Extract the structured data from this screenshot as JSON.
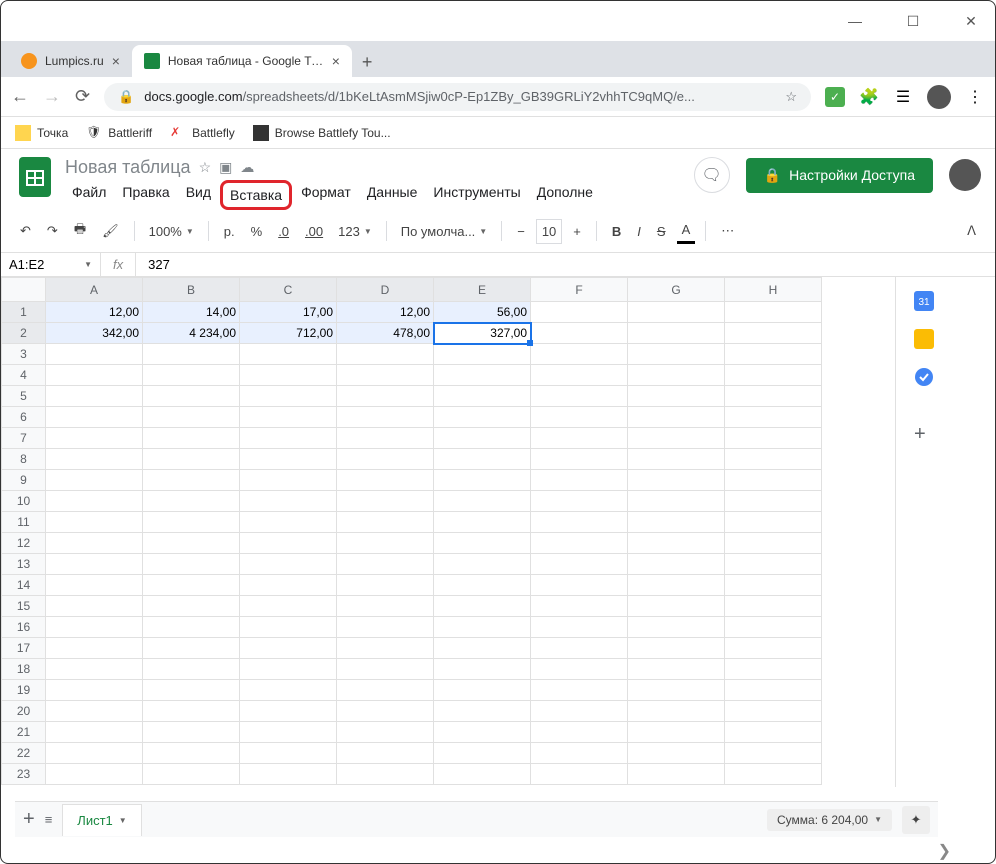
{
  "window": {
    "minimize": "—",
    "maximize": "☐",
    "close": "✕"
  },
  "tabs": [
    {
      "title": "Lumpics.ru",
      "active": false
    },
    {
      "title": "Новая таблица - Google Таблиц",
      "active": true
    }
  ],
  "newTab": "+",
  "addr": {
    "lock": "🔒",
    "domain": "docs.google.com",
    "path": "/spreadsheets/d/1bKeLtAsmMSjiw0cP-Ep1ZBy_GB39GRLiY2vhhTC9qMQ/e...",
    "star": "☆"
  },
  "bookmarks": [
    {
      "label": "Точка"
    },
    {
      "label": "Battleriff"
    },
    {
      "label": "Battlefly"
    },
    {
      "label": "Browse Battlefy Tou..."
    }
  ],
  "doc": {
    "title": "Новая таблица",
    "menus": [
      "Файл",
      "Правка",
      "Вид",
      "Вставка",
      "Формат",
      "Данные",
      "Инструменты",
      "Дополне"
    ],
    "highlightIdx": 3,
    "share": "Настройки Доступа"
  },
  "toolbar": {
    "zoom": "100%",
    "currency": "р.",
    "percent": "%",
    "dec0": ".0",
    "dec00": ".00",
    "fmt123": "123",
    "font": "По умолча...",
    "fontsize": "10",
    "bold": "B",
    "italic": "I",
    "strike": "S",
    "textcolor": "A"
  },
  "nameBox": "A1:E2",
  "fxLabel": "fx",
  "fxVal": "327",
  "cols": [
    "A",
    "B",
    "C",
    "D",
    "E",
    "F",
    "G",
    "H"
  ],
  "colSel": [
    0,
    1,
    2,
    3,
    4
  ],
  "rows": 23,
  "rowSel": [
    1,
    2
  ],
  "data": {
    "1": {
      "A": "12,00",
      "B": "14,00",
      "C": "17,00",
      "D": "12,00",
      "E": "56,00"
    },
    "2": {
      "A": "342,00",
      "B": "4 234,00",
      "C": "712,00",
      "D": "478,00",
      "E": "327,00"
    }
  },
  "activeCell": {
    "row": 2,
    "col": "E"
  },
  "selRange": {
    "r1": 1,
    "r2": 2,
    "cols": [
      "A",
      "B",
      "C",
      "D",
      "E"
    ]
  },
  "sheet": {
    "add": "+",
    "menu": "≡",
    "tab": "Лист1",
    "sum": "Сумма: 6 204,00"
  }
}
